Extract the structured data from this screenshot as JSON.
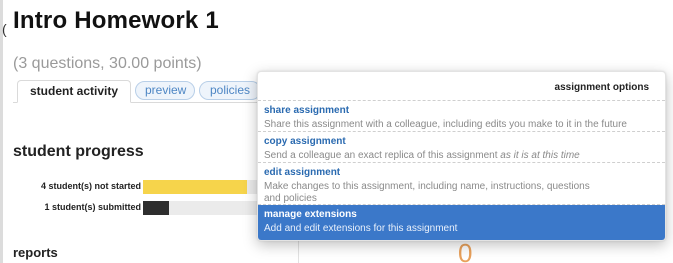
{
  "page": {
    "title": "Intro Homework 1",
    "summary": "(3 questions, 30.00 points)",
    "edge_glyph": "("
  },
  "tabs": [
    {
      "label": "student activity",
      "active": true
    },
    {
      "label": "preview",
      "active": false
    },
    {
      "label": "policies",
      "active": false
    }
  ],
  "progress": {
    "heading": "student progress",
    "rows": [
      {
        "label": "4 student(s) not started",
        "fraction": 0.69,
        "color": "#f6d44b"
      },
      {
        "label": "1 student(s) submitted",
        "fraction": 0.17,
        "color": "#2e2e2e"
      }
    ]
  },
  "reports": {
    "heading": "reports",
    "count": "0"
  },
  "menu": {
    "header": "assignment options",
    "items": [
      {
        "title": "share assignment",
        "desc": "Share this assignment with a colleague, including edits you make to it in the future"
      },
      {
        "title": "copy assignment",
        "desc": "Send a colleague an exact replica of this assignment",
        "desc_em": "as it is at this time"
      },
      {
        "title": "edit assignment",
        "desc": "Make changes to this assignment, including name, instructions, questions",
        "desc2": "and policies"
      },
      {
        "title": "manage extensions",
        "desc": "Add and edit extensions for this assignment",
        "highlighted": true
      }
    ]
  },
  "colors": {
    "accent_blue": "#3b78c9",
    "link_blue": "#2a6ab0",
    "not_started": "#f6d44b",
    "submitted": "#2e2e2e",
    "count_orange": "#e9a15b"
  }
}
